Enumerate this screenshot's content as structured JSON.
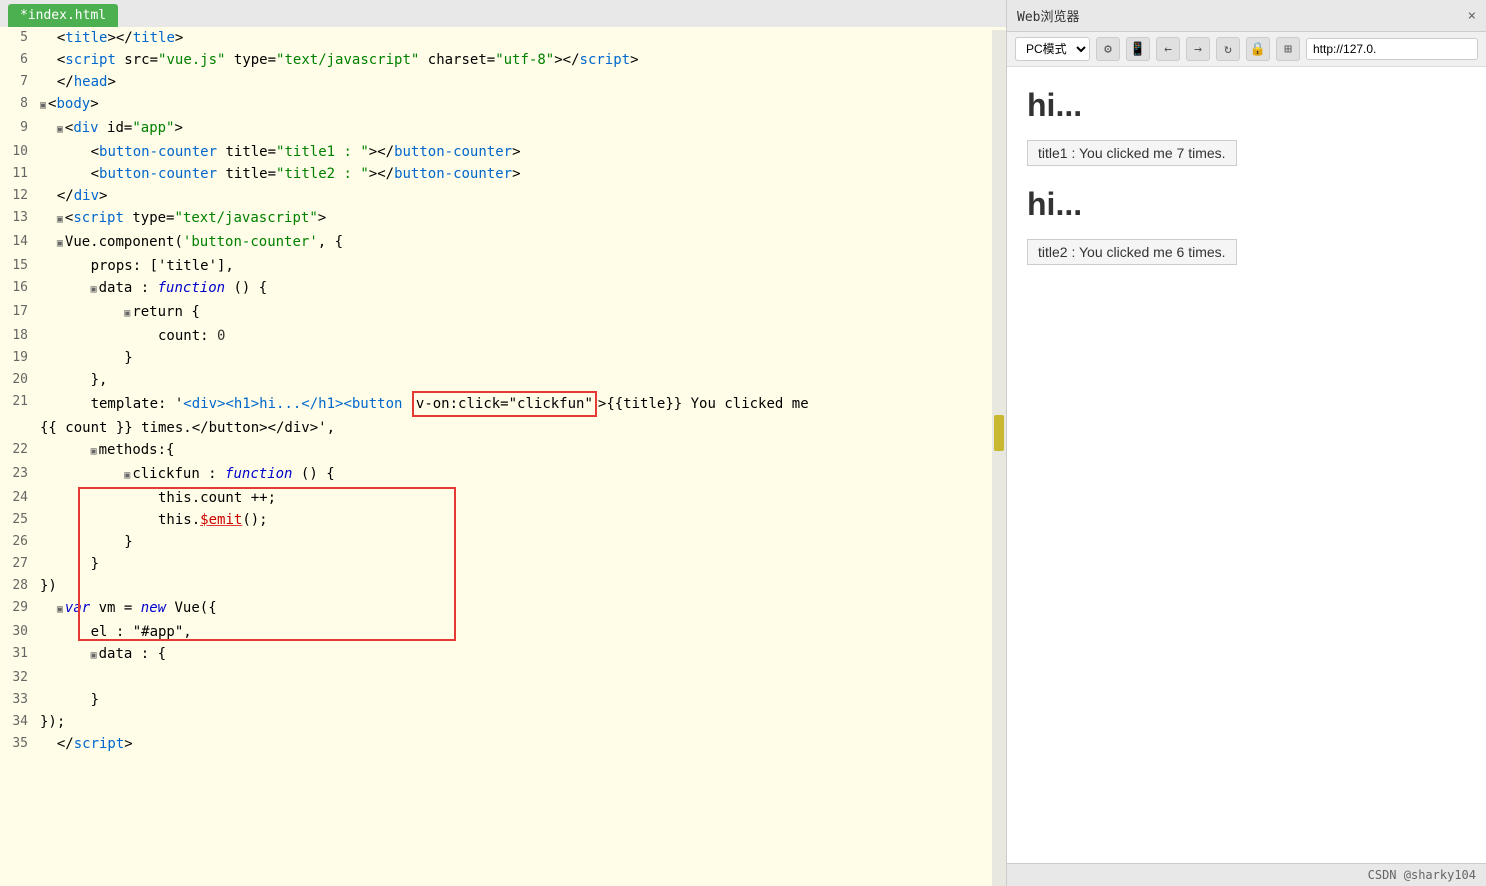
{
  "editor": {
    "tab_label": "*index.html",
    "lines": [
      {
        "num": 5,
        "indent": 0,
        "fold": false,
        "content": [
          {
            "text": "  <",
            "cls": "normal"
          },
          {
            "text": "title",
            "cls": "tag"
          },
          {
            "text": "></",
            "cls": "normal"
          },
          {
            "text": "title",
            "cls": "tag"
          },
          {
            "text": ">",
            "cls": "normal"
          }
        ]
      },
      {
        "num": 6,
        "indent": 0,
        "fold": false,
        "content": [
          {
            "text": "  <",
            "cls": "normal"
          },
          {
            "text": "script",
            "cls": "tag"
          },
          {
            "text": " src=",
            "cls": "normal"
          },
          {
            "text": "\"vue.js\"",
            "cls": "str"
          },
          {
            "text": " type=",
            "cls": "normal"
          },
          {
            "text": "\"text/javascript\"",
            "cls": "str"
          },
          {
            "text": " charset=",
            "cls": "normal"
          },
          {
            "text": "\"utf-8\"",
            "cls": "str"
          },
          {
            "text": "></",
            "cls": "normal"
          },
          {
            "text": "script",
            "cls": "tag"
          },
          {
            "text": ">",
            "cls": "normal"
          }
        ]
      },
      {
        "num": 7,
        "indent": 0,
        "fold": false,
        "content": [
          {
            "text": "  </",
            "cls": "normal"
          },
          {
            "text": "head",
            "cls": "tag"
          },
          {
            "text": ">",
            "cls": "normal"
          }
        ]
      },
      {
        "num": 8,
        "indent": 0,
        "fold": true,
        "content": [
          {
            "text": "<",
            "cls": "normal"
          },
          {
            "text": "body",
            "cls": "tag"
          },
          {
            "text": ">",
            "cls": "normal"
          }
        ]
      },
      {
        "num": 9,
        "indent": 0,
        "fold": true,
        "content": [
          {
            "text": "  <",
            "cls": "normal"
          },
          {
            "text": "div",
            "cls": "tag"
          },
          {
            "text": " id=",
            "cls": "normal"
          },
          {
            "text": "\"app\"",
            "cls": "str"
          },
          {
            "text": ">",
            "cls": "normal"
          }
        ]
      },
      {
        "num": 10,
        "indent": 0,
        "fold": false,
        "content": [
          {
            "text": "    <",
            "cls": "normal"
          },
          {
            "text": "button-counter",
            "cls": "tag"
          },
          {
            "text": " title=",
            "cls": "normal"
          },
          {
            "text": "\"title1 : \"",
            "cls": "str"
          },
          {
            "text": "></",
            "cls": "normal"
          },
          {
            "text": "button-counter",
            "cls": "tag"
          },
          {
            "text": ">",
            "cls": "normal"
          }
        ]
      },
      {
        "num": 11,
        "indent": 0,
        "fold": false,
        "content": [
          {
            "text": "    <",
            "cls": "normal"
          },
          {
            "text": "button-counter",
            "cls": "tag"
          },
          {
            "text": " title=",
            "cls": "normal"
          },
          {
            "text": "\"title2 : \"",
            "cls": "str"
          },
          {
            "text": "></",
            "cls": "normal"
          },
          {
            "text": "button-counter",
            "cls": "tag"
          },
          {
            "text": ">",
            "cls": "normal"
          }
        ]
      },
      {
        "num": 12,
        "indent": 0,
        "fold": false,
        "content": [
          {
            "text": "  </",
            "cls": "normal"
          },
          {
            "text": "div",
            "cls": "tag"
          },
          {
            "text": ">",
            "cls": "normal"
          }
        ]
      },
      {
        "num": 13,
        "indent": 0,
        "fold": true,
        "content": [
          {
            "text": "  <",
            "cls": "normal"
          },
          {
            "text": "script",
            "cls": "tag"
          },
          {
            "text": " type=",
            "cls": "normal"
          },
          {
            "text": "\"text/javascript\"",
            "cls": "str"
          },
          {
            "text": ">",
            "cls": "normal"
          }
        ]
      },
      {
        "num": 14,
        "indent": 0,
        "fold": true,
        "content": [
          {
            "text": "Vue.",
            "cls": "normal"
          },
          {
            "text": "component",
            "cls": "normal"
          },
          {
            "text": "('button-counter', {",
            "cls": "str"
          }
        ]
      },
      {
        "num": 15,
        "indent": 0,
        "fold": false,
        "content": [
          {
            "text": "    props: ['title'],",
            "cls": "normal"
          }
        ]
      },
      {
        "num": 16,
        "indent": 0,
        "fold": true,
        "content": [
          {
            "text": "    ",
            "cls": "normal"
          },
          {
            "text": "data",
            "cls": "normal"
          },
          {
            "text": " : ",
            "cls": "normal"
          },
          {
            "text": "function",
            "cls": "fn-kw"
          },
          {
            "text": " () {",
            "cls": "normal"
          }
        ]
      },
      {
        "num": 17,
        "indent": 0,
        "fold": true,
        "content": [
          {
            "text": "        return {",
            "cls": "normal"
          }
        ]
      },
      {
        "num": 18,
        "indent": 0,
        "fold": false,
        "content": [
          {
            "text": "            count: ",
            "cls": "normal"
          },
          {
            "text": "0",
            "cls": "num"
          }
        ]
      },
      {
        "num": 19,
        "indent": 0,
        "fold": false,
        "content": [
          {
            "text": "        }",
            "cls": "normal"
          }
        ]
      },
      {
        "num": 20,
        "indent": 0,
        "fold": false,
        "content": [
          {
            "text": "    },",
            "cls": "normal"
          }
        ]
      },
      {
        "num": 21,
        "indent": 0,
        "fold": false,
        "raw": "template_line"
      },
      {
        "num": 22,
        "indent": 0,
        "fold": true,
        "content": [
          {
            "text": "    methods:{",
            "cls": "normal"
          }
        ]
      },
      {
        "num": 23,
        "indent": 0,
        "fold": true,
        "content": [
          {
            "text": "        clickfun : ",
            "cls": "normal"
          },
          {
            "text": "function",
            "cls": "fn-kw"
          },
          {
            "text": " () {",
            "cls": "normal"
          }
        ]
      },
      {
        "num": 24,
        "indent": 0,
        "fold": false,
        "content": [
          {
            "text": "            this.count ++;",
            "cls": "normal"
          }
        ]
      },
      {
        "num": 25,
        "indent": 0,
        "fold": false,
        "content": [
          {
            "text": "            this.",
            "cls": "normal"
          },
          {
            "text": "$emit",
            "cls": "highlight-red"
          },
          {
            "text": "();",
            "cls": "normal"
          }
        ]
      },
      {
        "num": 26,
        "indent": 0,
        "fold": false,
        "content": [
          {
            "text": "        }",
            "cls": "normal"
          }
        ]
      },
      {
        "num": 27,
        "indent": 0,
        "fold": false,
        "content": [
          {
            "text": "    }",
            "cls": "normal"
          }
        ]
      },
      {
        "num": 28,
        "indent": 0,
        "fold": false,
        "content": [
          {
            "text": "})",
            "cls": "normal"
          }
        ]
      },
      {
        "num": 29,
        "indent": 0,
        "fold": true,
        "content": [
          {
            "text": "var",
            "cls": "kw"
          },
          {
            "text": " vm = ",
            "cls": "normal"
          },
          {
            "text": "new",
            "cls": "kw"
          },
          {
            "text": " Vue({",
            "cls": "normal"
          }
        ]
      },
      {
        "num": 30,
        "indent": 0,
        "fold": false,
        "content": [
          {
            "text": "    el : \"#app\",",
            "cls": "normal"
          }
        ]
      },
      {
        "num": 31,
        "indent": 0,
        "fold": true,
        "content": [
          {
            "text": "    ",
            "cls": "normal"
          },
          {
            "text": "data",
            "cls": "normal"
          },
          {
            "text": " : {",
            "cls": "normal"
          }
        ]
      },
      {
        "num": 32,
        "indent": 0,
        "fold": false,
        "content": [
          {
            "text": "",
            "cls": "normal"
          }
        ]
      },
      {
        "num": 33,
        "indent": 0,
        "fold": false,
        "content": [
          {
            "text": "    }",
            "cls": "normal"
          }
        ]
      },
      {
        "num": 34,
        "indent": 0,
        "fold": false,
        "content": [
          {
            "text": "});",
            "cls": "normal"
          }
        ]
      },
      {
        "num": 35,
        "indent": 0,
        "fold": false,
        "content": [
          {
            "text": "  </",
            "cls": "normal"
          },
          {
            "text": "script",
            "cls": "tag"
          },
          {
            "text": ">",
            "cls": "normal"
          }
        ]
      }
    ]
  },
  "browser": {
    "tab_label": "Web浏览器",
    "mode_options": [
      "PC模式"
    ],
    "mode_selected": "PC模式",
    "address": "http://127.0.",
    "preview": {
      "section1": {
        "heading": "hi...",
        "button_text": "title1 : You clicked me 7 times."
      },
      "section2": {
        "heading": "hi...",
        "button_text": "title2 : You clicked me 6 times."
      }
    }
  },
  "footer": {
    "text": "CSDN @sharky104"
  },
  "icons": {
    "settings": "⚙",
    "mobile": "📱",
    "back": "←",
    "forward": "→",
    "refresh": "↻",
    "lock": "🔒",
    "grid": "⊞",
    "fold_open": "▣",
    "fold_close": "▣",
    "tab_close": "×"
  }
}
